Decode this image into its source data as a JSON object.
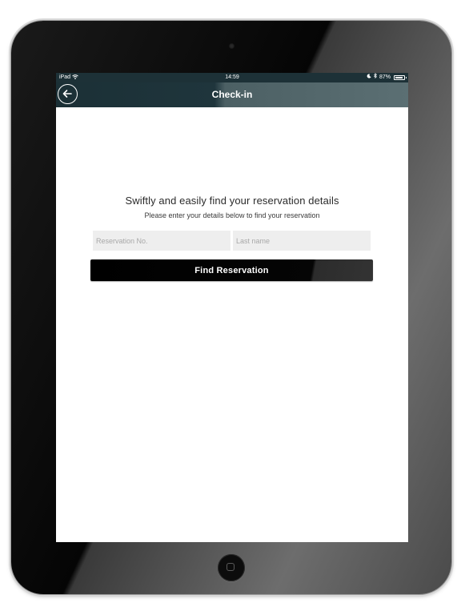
{
  "status_bar": {
    "carrier": "iPad",
    "time": "14:59",
    "battery_percent": "87%"
  },
  "nav": {
    "title": "Check-in"
  },
  "main": {
    "headline": "Swiftly and easily find your reservation details",
    "subline": "Please enter your details below to find your reservation",
    "reservation_placeholder": "Reservation No.",
    "lastname_placeholder": "Last name",
    "find_button_label": "Find Reservation"
  },
  "colors": {
    "nav_background": "#1d3137",
    "button_background": "#000000",
    "input_background": "#eeeeee"
  },
  "icons": {
    "back": "back-arrow-icon",
    "wifi": "wifi-icon",
    "moon": "moon-icon",
    "bluetooth": "bluetooth-icon",
    "battery": "battery-icon"
  }
}
